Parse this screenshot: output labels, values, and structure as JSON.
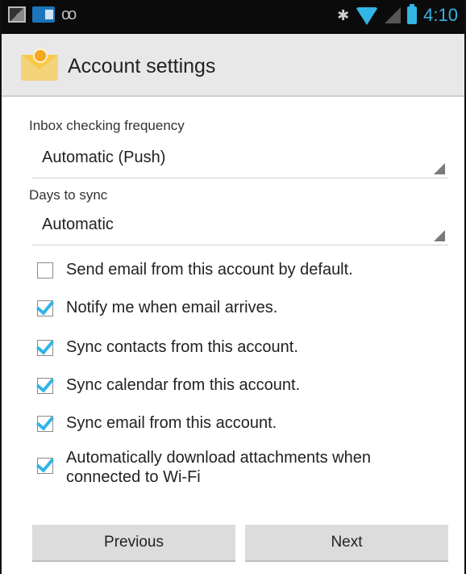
{
  "statusbar": {
    "time": "4:10",
    "icons": [
      "picture-icon",
      "outlook-icon",
      "voicemail-icon",
      "bluetooth-icon",
      "wifi-icon",
      "signal-icon",
      "battery-icon"
    ]
  },
  "actionbar": {
    "title": "Account settings",
    "app_icon": "email-envelope-icon"
  },
  "inbox_frequency": {
    "label": "Inbox checking frequency",
    "value": "Automatic (Push)"
  },
  "days_to_sync": {
    "label": "Days to sync",
    "value": "Automatic"
  },
  "options": [
    {
      "label": "Send email from this account by default.",
      "checked": false
    },
    {
      "label": "Notify me when email arrives.",
      "checked": true
    },
    {
      "label": "Sync contacts from this account.",
      "checked": true
    },
    {
      "label": "Sync calendar from this account.",
      "checked": true
    },
    {
      "label": "Sync email from this account.",
      "checked": true
    },
    {
      "label": "Automatically download attachments when connected to Wi-Fi",
      "checked": true
    }
  ],
  "buttons": {
    "previous": "Previous",
    "next": "Next"
  },
  "colors": {
    "accent": "#33b5e5",
    "statusbar_bg": "#0b0b0b",
    "actionbar_bg": "#e8e8e8"
  }
}
